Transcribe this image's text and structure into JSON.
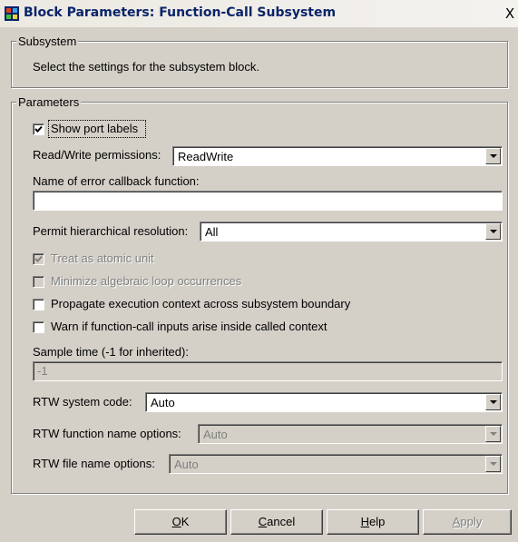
{
  "window": {
    "title": "Block Parameters: Function-Call Subsystem",
    "close_glyph": "X"
  },
  "subsystem_group": {
    "legend": "Subsystem",
    "description": "Select the settings for the subsystem block."
  },
  "parameters_group": {
    "legend": "Parameters",
    "show_port_labels": {
      "label": "Show port labels",
      "checked": true
    },
    "read_write": {
      "label": "Read/Write permissions:",
      "value": "ReadWrite"
    },
    "error_callback": {
      "label": "Name of error callback function:",
      "value": ""
    },
    "hierarchical": {
      "label": "Permit hierarchical resolution:",
      "value": "All"
    },
    "atomic_unit": {
      "label": "Treat as atomic unit",
      "checked": true,
      "enabled": false
    },
    "minimize_loop": {
      "label": "Minimize algebraic loop occurrences",
      "checked": false,
      "enabled": false
    },
    "propagate_context": {
      "label": "Propagate execution context across subsystem boundary",
      "checked": false
    },
    "warn_inputs": {
      "label": "Warn if function-call inputs arise inside called context",
      "checked": false
    },
    "sample_time": {
      "label": "Sample time (-1 for inherited):",
      "value": "-1"
    },
    "rtw_system_code": {
      "label": "RTW system code:",
      "value": "Auto"
    },
    "rtw_function_name": {
      "label": "RTW function name options:",
      "value": "Auto"
    },
    "rtw_file_name": {
      "label": "RTW file name options:",
      "value": "Auto"
    }
  },
  "buttons": {
    "ok": {
      "mnemonic": "O",
      "rest": "K"
    },
    "cancel": {
      "mnemonic": "C",
      "rest": "ancel"
    },
    "help": {
      "mnemonic": "H",
      "rest": "elp"
    },
    "apply": {
      "mnemonic": "A",
      "rest": "pply"
    }
  },
  "icons": {
    "app": "simulink-block-icon",
    "close": "close-icon",
    "dropdown": "chevron-down-icon",
    "checkbox_check": "check-icon"
  }
}
